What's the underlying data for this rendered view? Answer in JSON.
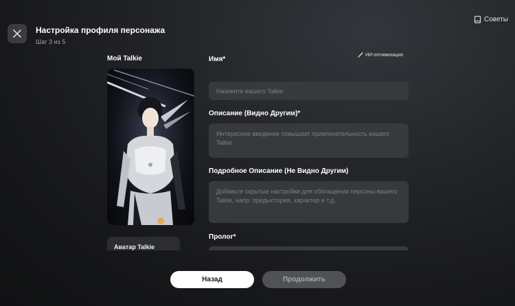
{
  "header": {
    "title": "Настройка профиля персонажа",
    "step": "Шаг 3 из 5",
    "tips_label": "Советы"
  },
  "preview": {
    "label": "Мой Talkie",
    "avatar_tab_label": "Аватар Talkie"
  },
  "form": {
    "ai_button_label": "ИИ-оптимизация",
    "name": {
      "label": "Имя*",
      "value": "",
      "placeholder": "Назовите вашего Talkie"
    },
    "description": {
      "label": "Описание (Видно Другим)*",
      "value": "",
      "placeholder": "Интересное введение повышает привлекательность вашего Talkie"
    },
    "detailed": {
      "label": "Подробное Описание (Не Видно Другим)",
      "value": "",
      "placeholder": "Добавьте скрытые настройки для обогащения персоны вашего Talkie, напр. предыстория, характер и т.д."
    },
    "prologue": {
      "label": "Пролог*"
    }
  },
  "footer": {
    "back_label": "Назад",
    "continue_label": "Продолжить"
  },
  "colors": {
    "accent_white": "#ffffff",
    "disabled_button": "#505256",
    "input_bg": "#37393d"
  }
}
